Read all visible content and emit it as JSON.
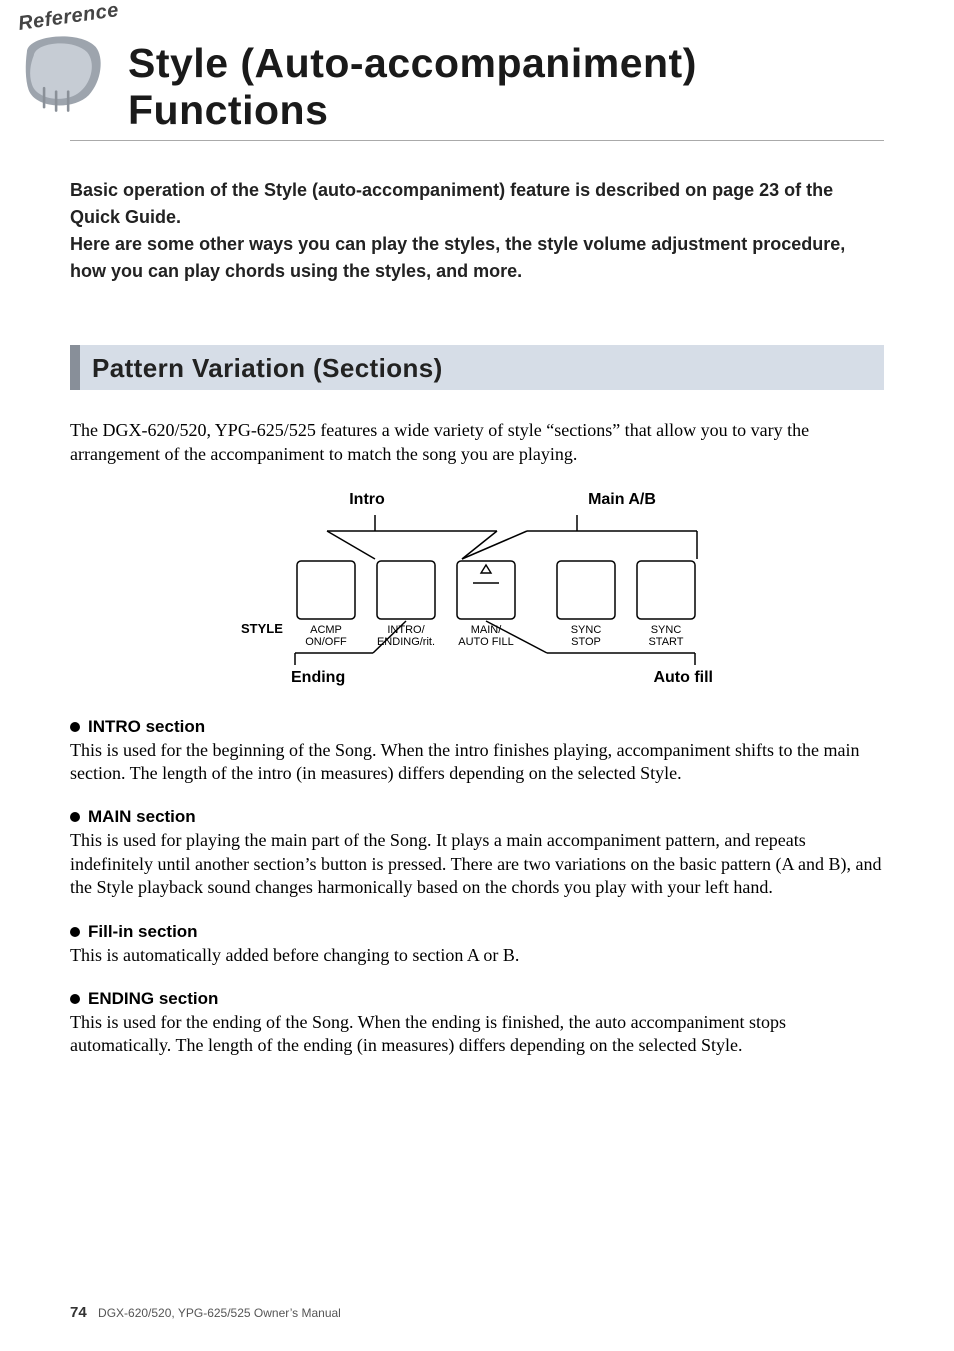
{
  "badge": "Reference",
  "title": "Style (Auto-accompaniment) Functions",
  "intro_lines": [
    "Basic operation of the Style (auto-accompaniment) feature is described on page 23 of the Quick Guide.",
    "Here are some other ways you can play the styles, the style volume adjustment procedure, how you can play chords using the styles, and more."
  ],
  "section_band": "Pattern Variation (Sections)",
  "section_intro": "The DGX-620/520, YPG-625/525 features a wide variety of style “sections” that allow you to vary the arrangement of the accompaniment to match the song you are playing.",
  "diagram": {
    "top_labels": {
      "intro": "Intro",
      "main": "Main A/B"
    },
    "bottom_labels": {
      "ending": "Ending",
      "autofill": "Auto fill"
    },
    "panel": {
      "style_word": "STYLE",
      "buttons": [
        {
          "line1": "ACMP",
          "line2": "ON/OFF"
        },
        {
          "line1": "INTRO/",
          "line2": "ENDING/rit."
        },
        {
          "line1": "MAIN/",
          "line2": "AUTO FILL"
        },
        {
          "line1": "SYNC",
          "line2": "STOP"
        },
        {
          "line1": "SYNC",
          "line2": "START"
        }
      ]
    }
  },
  "sections": [
    {
      "heading": "INTRO section",
      "text": "This is used for the beginning of the Song. When the intro finishes playing, accompaniment shifts to the main section. The length of the intro (in measures) differs depending on the selected Style."
    },
    {
      "heading": "MAIN section",
      "text": "This is used for playing the main part of the Song. It plays a main accompaniment pattern, and repeats indefinitely until another section’s button is pressed. There are two variations on the basic pattern (A and B), and the Style playback sound changes harmonically based on the chords you play with your left hand."
    },
    {
      "heading": "Fill-in section",
      "text": "This is automatically added before changing to section A or B."
    },
    {
      "heading": "ENDING section",
      "text": "This is used for the ending of the Song. When the ending is finished, the auto accompaniment stops automatically. The length of the ending (in measures) differs depending on the selected Style."
    }
  ],
  "footer": {
    "page": "74",
    "text": "DGX-620/520, YPG-625/525  Owner’s Manual"
  }
}
